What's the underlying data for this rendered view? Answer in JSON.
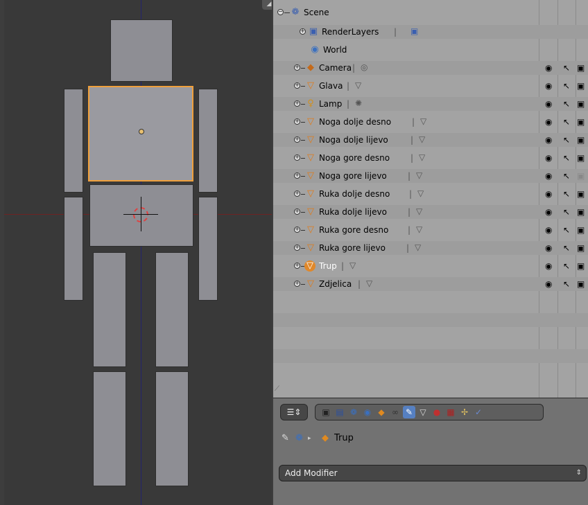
{
  "outliner": {
    "rows": [
      {
        "label": "Scene",
        "icon": "scene-icon",
        "sub_icon": ""
      },
      {
        "label": "RenderLayers",
        "icon": "renderlayers-icon",
        "sub_icon": "renderlayer-data-icon"
      },
      {
        "label": "World",
        "icon": "world-icon",
        "sub_icon": ""
      },
      {
        "label": "Camera",
        "icon": "camera-object-icon",
        "sub_icon": "camera-data-icon"
      },
      {
        "label": "Glava",
        "icon": "mesh-object-icon",
        "sub_icon": "mesh-data-icon"
      },
      {
        "label": "Lamp",
        "icon": "lamp-object-icon",
        "sub_icon": "lamp-data-icon"
      },
      {
        "label": "Noga dolje desno",
        "icon": "mesh-object-icon",
        "sub_icon": "mesh-data-icon"
      },
      {
        "label": "Noga dolje lijevo",
        "icon": "mesh-object-icon",
        "sub_icon": "mesh-data-icon"
      },
      {
        "label": "Noga gore desno",
        "icon": "mesh-object-icon",
        "sub_icon": "mesh-data-icon"
      },
      {
        "label": "Noga gore lijevo",
        "icon": "mesh-object-icon",
        "sub_icon": "mesh-data-icon"
      },
      {
        "label": "Ruka dolje desno",
        "icon": "mesh-object-icon",
        "sub_icon": "mesh-data-icon"
      },
      {
        "label": "Ruka dolje lijevo",
        "icon": "mesh-object-icon",
        "sub_icon": "mesh-data-icon"
      },
      {
        "label": "Ruka gore desno",
        "icon": "mesh-object-icon",
        "sub_icon": "mesh-data-icon"
      },
      {
        "label": "Ruka gore lijevo",
        "icon": "mesh-object-icon",
        "sub_icon": "mesh-data-icon"
      },
      {
        "label": "Trup",
        "icon": "mesh-object-icon",
        "sub_icon": "mesh-data-icon",
        "active": true
      },
      {
        "label": "Zdjelica",
        "icon": "mesh-object-icon",
        "sub_icon": "mesh-data-icon"
      }
    ]
  },
  "properties": {
    "breadcrumb": {
      "object_name": "Trup"
    },
    "add_modifier_label": "Add Modifier",
    "active_tab": "modifiers-tab"
  },
  "colors": {
    "selection_outline": "#f0a03c",
    "active_tab": "#5680c2",
    "viewport_bg": "#393939",
    "outliner_bg": "#a3a3a3"
  }
}
